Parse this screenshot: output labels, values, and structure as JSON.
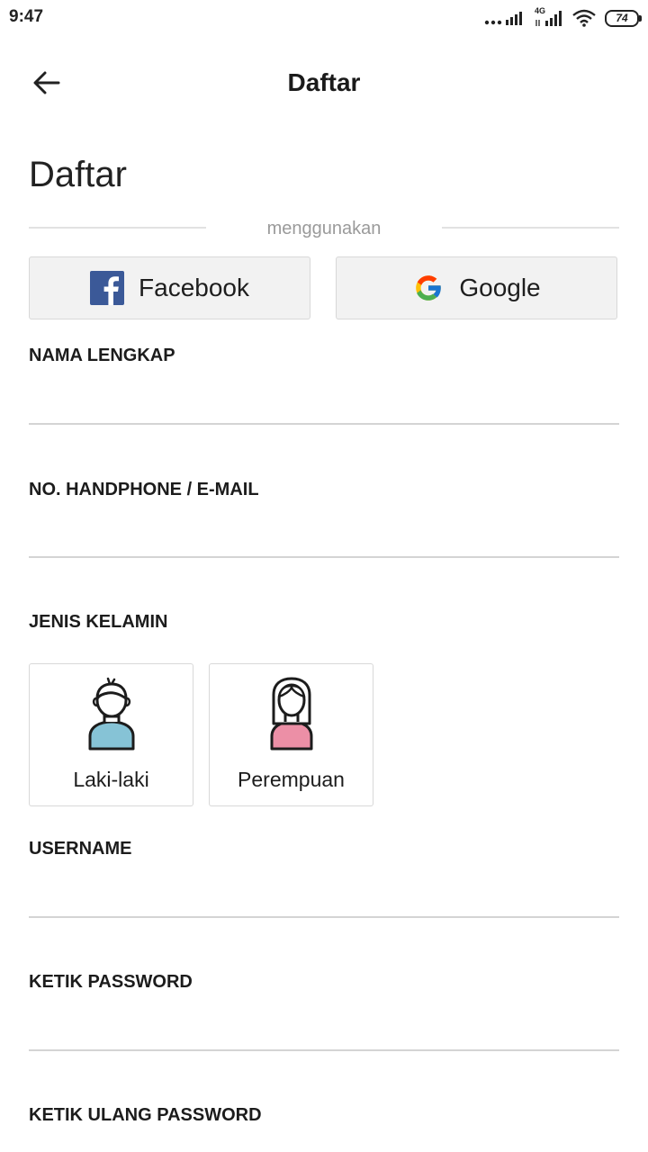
{
  "status_bar": {
    "time": "9:47",
    "network_label": "4G",
    "battery": "74"
  },
  "app_bar": {
    "title": "Daftar"
  },
  "page": {
    "heading": "Daftar",
    "divider_text": "menggunakan"
  },
  "social": {
    "facebook_label": "Facebook",
    "google_label": "Google",
    "facebook_color": "#3b5998"
  },
  "form": {
    "full_name": {
      "label": "NAMA LENGKAP",
      "value": ""
    },
    "phone_email": {
      "label": "NO. HANDPHONE / E-MAIL",
      "value": ""
    },
    "gender": {
      "label": "JENIS KELAMIN",
      "options": [
        "Laki-laki",
        "Perempuan"
      ]
    },
    "username": {
      "label": "USERNAME",
      "value": ""
    },
    "password": {
      "label": "KETIK PASSWORD",
      "value": ""
    },
    "password_confirm": {
      "label": "KETIK ULANG PASSWORD",
      "value": ""
    }
  },
  "colors": {
    "male_shirt": "#86c3d6",
    "female_shirt": "#ec8fa6"
  }
}
